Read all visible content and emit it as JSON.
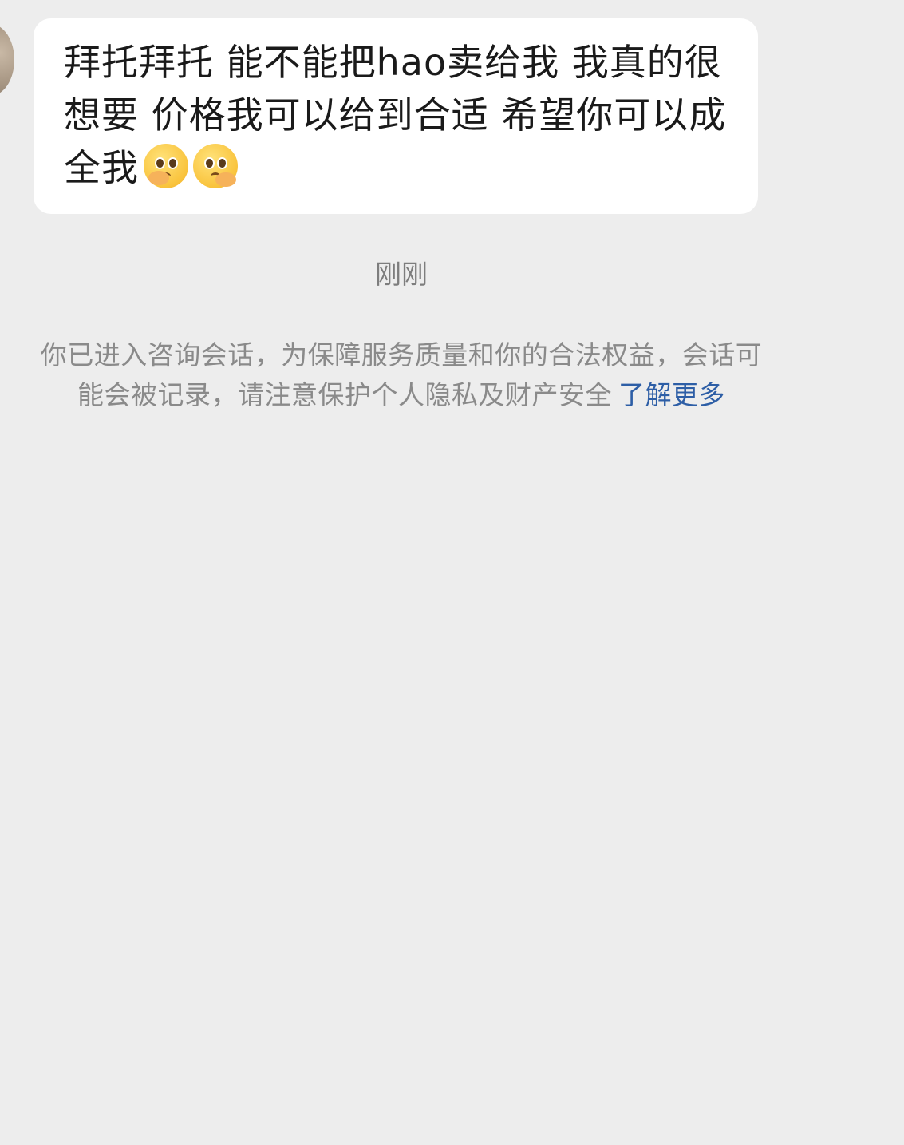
{
  "chat": {
    "incoming_message": {
      "text": "拜托拜托 能不能把hao卖给我 我真的很想要 价格我可以给到合适 希望你可以成全我",
      "emojis": [
        "pleading-hug-emoji",
        "pleading-hug-emoji"
      ]
    },
    "timestamp": "刚刚",
    "system_notice": {
      "line1": "你已进入咨询会话，为保障服务质量和你的合法权益，会话可",
      "line2": "能会被记录，请注意保护个人隐私及财产安全",
      "link_label": "了解更多"
    }
  },
  "colors": {
    "background": "#ededed",
    "bubble": "#ffffff",
    "link": "#2d5ea6"
  }
}
